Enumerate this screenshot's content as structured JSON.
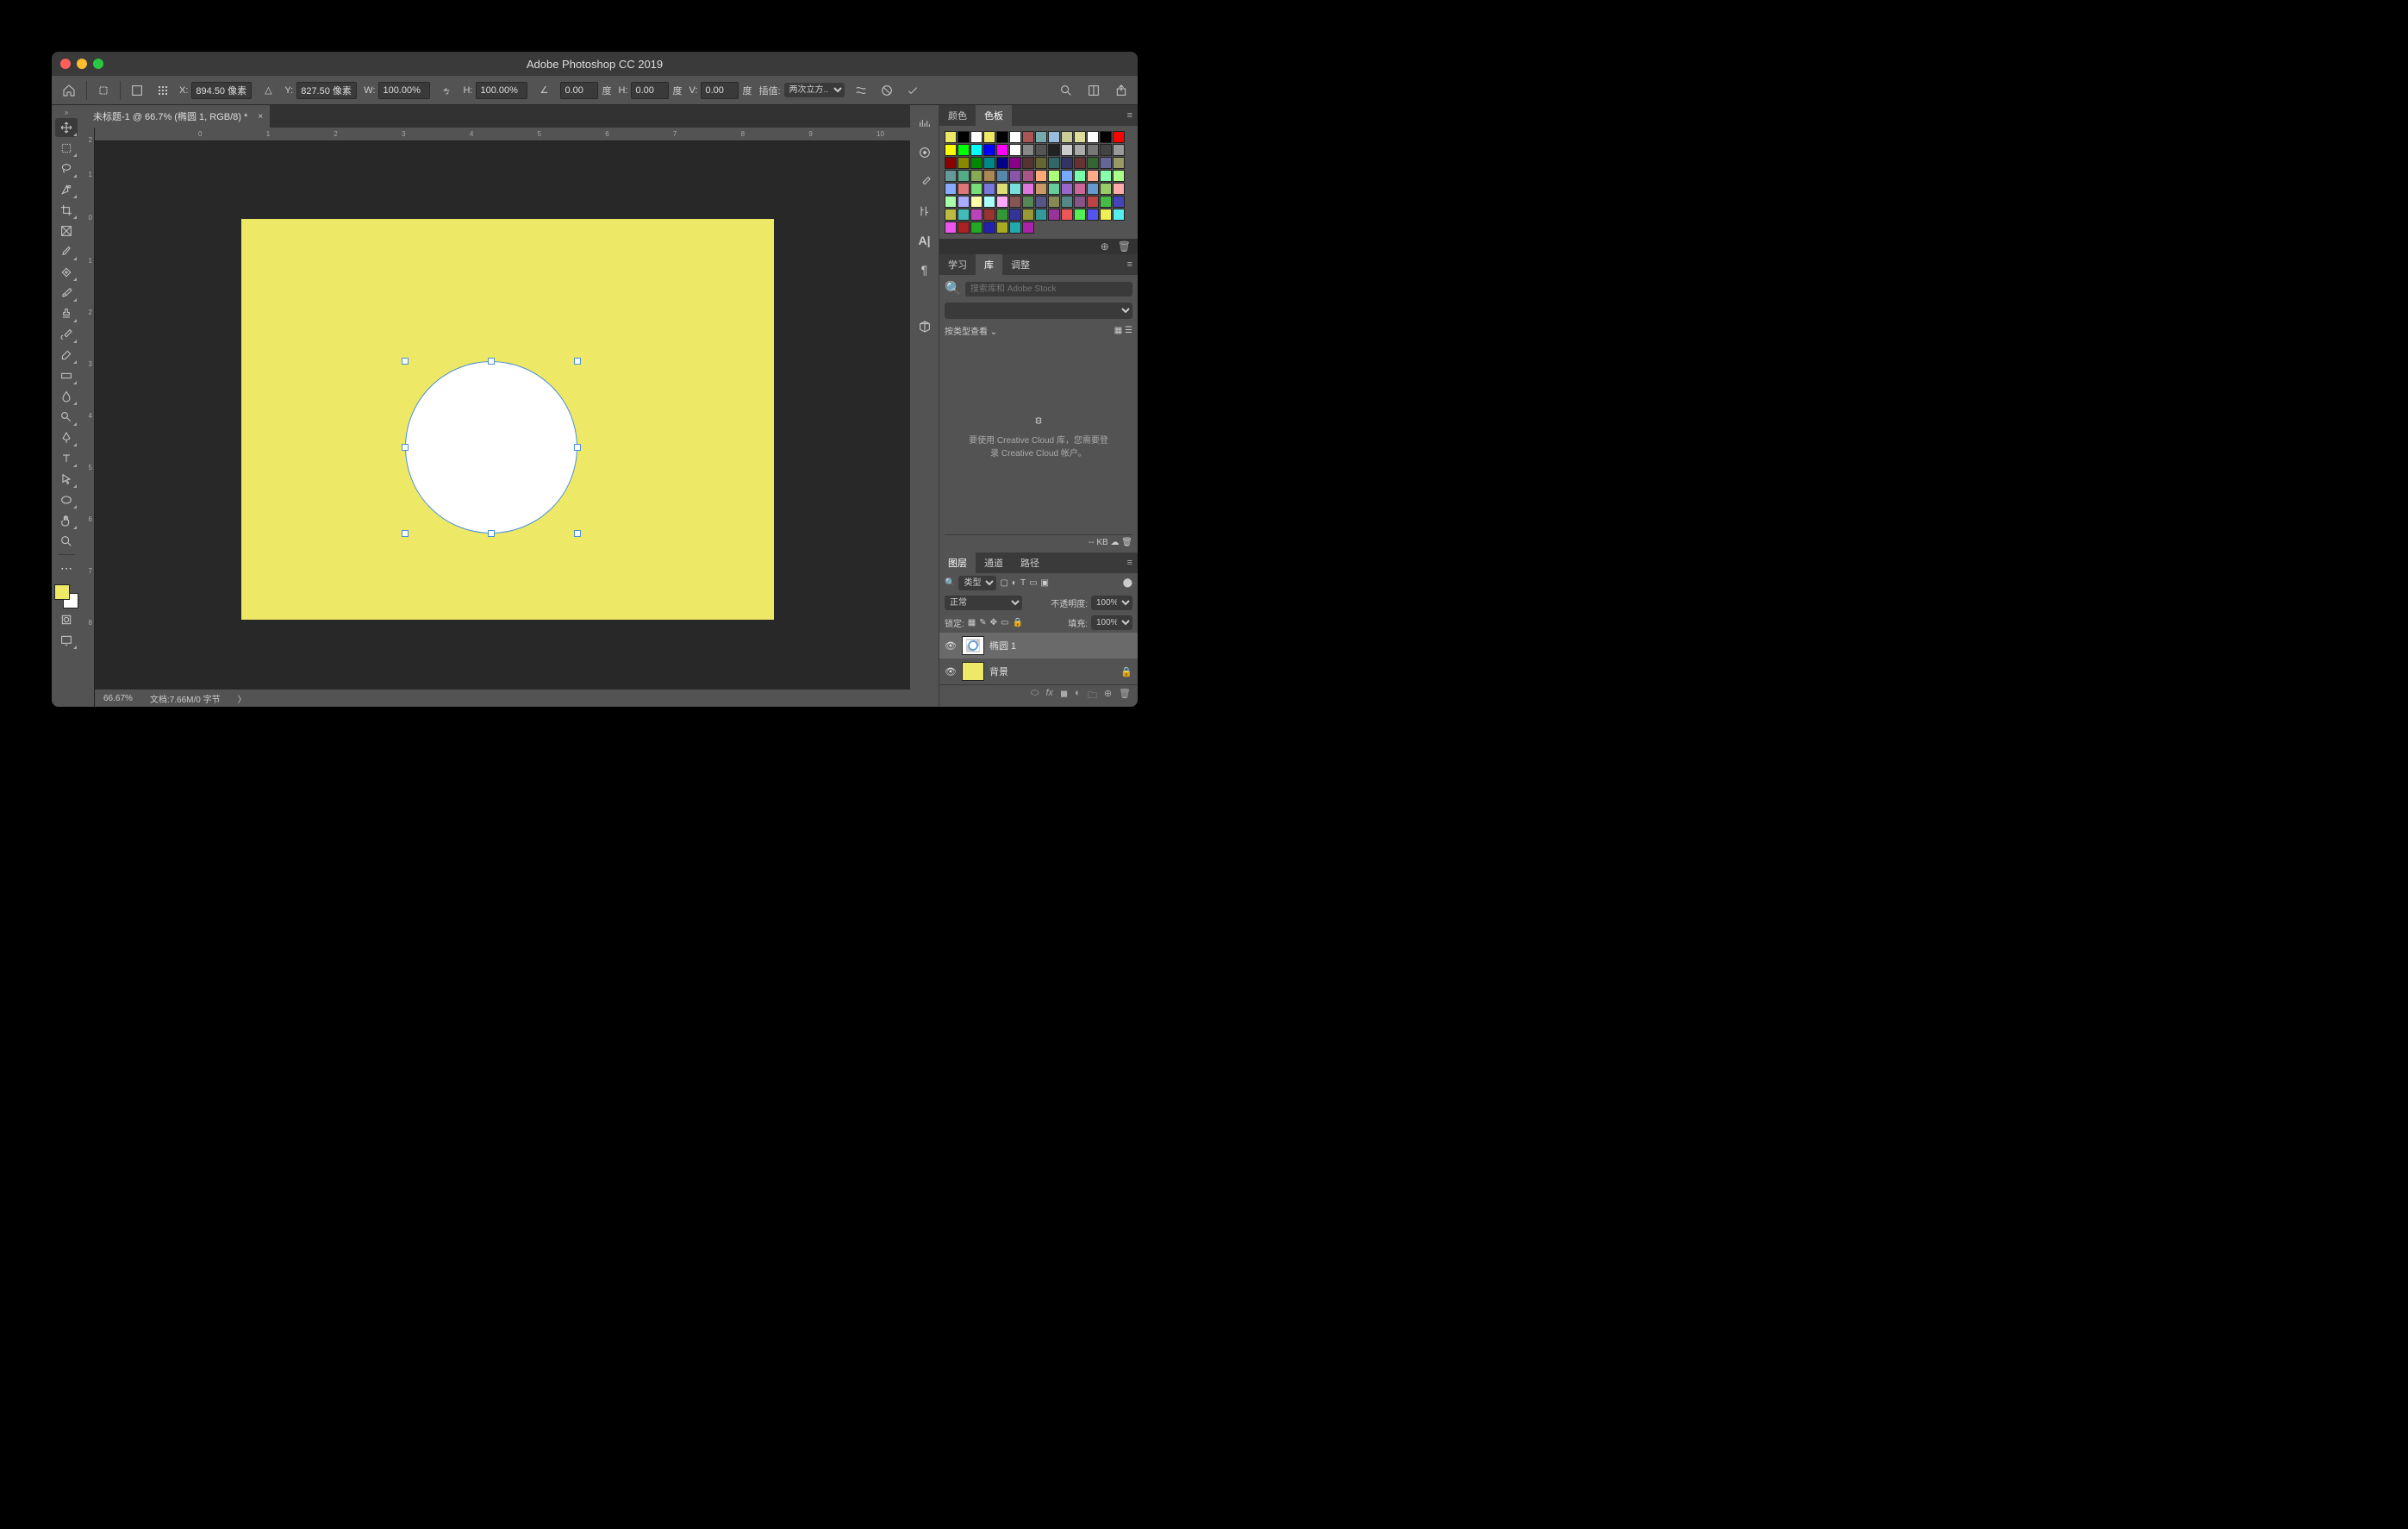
{
  "app_title": "Adobe Photoshop CC 2019",
  "options": {
    "x_label": "X:",
    "x_value": "894.50 像素",
    "y_label": "Y:",
    "y_value": "827.50 像素",
    "w_label": "W:",
    "w_value": "100.00%",
    "h_label": "H:",
    "h_value": "100.00%",
    "angle_label": "",
    "angle_value": "0.00",
    "angle_unit": "度",
    "h_skew_label": "H:",
    "h_skew_value": "0.00",
    "h_skew_unit": "度",
    "v_skew_label": "V:",
    "v_skew_value": "0.00",
    "v_skew_unit": "度",
    "interp_label": "插值:",
    "interp_value": "两次立方..."
  },
  "doc_tab": "未标题-1 @ 66.7% (椭圆 1, RGB/8) *",
  "rulers": {
    "h": [
      "0",
      "1",
      "2",
      "3",
      "4",
      "5",
      "6",
      "7",
      "8",
      "9",
      "10"
    ],
    "v": [
      "2",
      "1",
      "0",
      "1",
      "2",
      "3",
      "4",
      "5",
      "6",
      "7",
      "8"
    ]
  },
  "status": {
    "zoom": "66.67%",
    "doc": "文档:7.66M/0 字节"
  },
  "panels": {
    "color_tab": "颜色",
    "swatch_tab": "色板",
    "swatch_colors": [
      "#eee867",
      "#000",
      "#fff",
      "#eee867",
      "#000",
      "#fff",
      "#a55",
      "#7aa",
      "#9bd",
      "#cc9",
      "#dd9",
      "#fff",
      "#000",
      "#f00",
      "#ff0",
      "#0f0",
      "#0ff",
      "#00f",
      "#f0f",
      "#fff",
      "#888",
      "#555",
      "#222",
      "#ccc",
      "#aaa",
      "#777",
      "#444",
      "#999",
      "#800",
      "#880",
      "#080",
      "#088",
      "#008",
      "#808",
      "#533",
      "#663",
      "#366",
      "#336",
      "#633",
      "#363",
      "#669",
      "#996",
      "#699",
      "#5a8",
      "#8a5",
      "#a85",
      "#58a",
      "#85a",
      "#a58",
      "#fa7",
      "#af7",
      "#7af",
      "#7fa",
      "#fa8",
      "#8fa",
      "#af8",
      "#8af",
      "#d77",
      "#7d7",
      "#77d",
      "#dd7",
      "#7dd",
      "#d7d",
      "#c96",
      "#6c9",
      "#96c",
      "#c69",
      "#69c",
      "#9c6",
      "#faa",
      "#afa",
      "#aaf",
      "#ffa",
      "#aff",
      "#faf",
      "#855",
      "#585",
      "#558",
      "#885",
      "#588",
      "#858",
      "#b44",
      "#4b4",
      "#44b",
      "#bb4",
      "#4bb",
      "#b4b",
      "#933",
      "#393",
      "#339",
      "#993",
      "#399",
      "#939",
      "#e55",
      "#5e5",
      "#55e",
      "#ee5",
      "#5ee",
      "#e5e",
      "#a22",
      "#2a2",
      "#22a",
      "#aa2",
      "#2aa",
      "#a2a"
    ],
    "learn_tab": "学习",
    "lib_tab": "库",
    "adjust_tab": "调整",
    "search_placeholder": "搜索库和 Adobe Stock",
    "view_by_type": "按类型查看",
    "cc_msg1": "要使用 Creative Cloud 库，您需要登",
    "cc_msg2": "录 Creative Cloud 帐户。",
    "size_kb": "-- KB",
    "layers_tab": "图层",
    "channels_tab": "通道",
    "paths_tab": "路径",
    "kind_label": "类型",
    "blend_mode": "正常",
    "opacity_label": "不透明度:",
    "opacity_value": "100%",
    "lock_label": "锁定:",
    "fill_label": "填充:",
    "fill_value": "100%",
    "layer1": "椭圆 1",
    "layer2": "背景"
  }
}
